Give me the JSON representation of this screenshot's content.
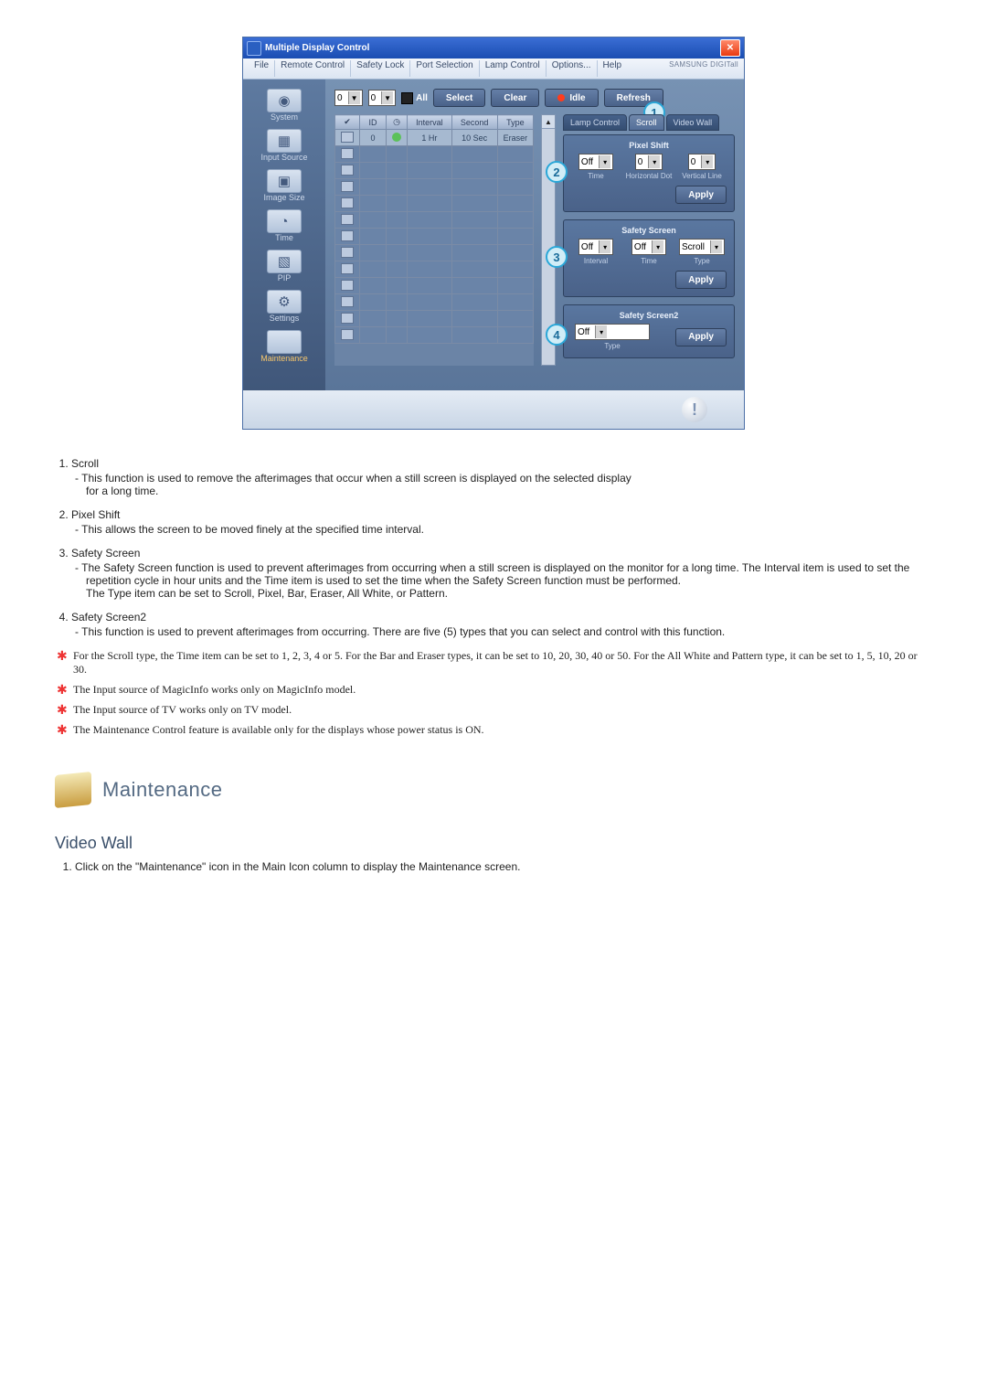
{
  "window": {
    "title": "Multiple Display Control"
  },
  "menu": {
    "file": "File",
    "remote": "Remote Control",
    "safety": "Safety Lock",
    "port": "Port Selection",
    "lamp": "Lamp Control",
    "options": "Options...",
    "help": "Help",
    "brand": "SAMSUNG DIGITall"
  },
  "sidebar": {
    "items": [
      {
        "label": "System"
      },
      {
        "label": "Input Source"
      },
      {
        "label": "Image Size"
      },
      {
        "label": "Time"
      },
      {
        "label": "PIP"
      },
      {
        "label": "Settings"
      },
      {
        "label": "Maintenance"
      }
    ]
  },
  "toolbar": {
    "dd1": "0",
    "dd2": "0",
    "all": "All",
    "select": "Select",
    "clear": "Clear",
    "idle": "Idle",
    "refresh": "Refresh"
  },
  "grid": {
    "cols": {
      "id": "ID",
      "interval": "Interval",
      "second": "Second",
      "type": "Type"
    },
    "row": {
      "id": "0",
      "interval": "1 Hr",
      "second": "10 Sec",
      "type": "Eraser"
    }
  },
  "tabs": {
    "lamp": "Lamp Control",
    "scroll": "Scroll",
    "video": "Video Wall"
  },
  "pixelshift": {
    "title": "Pixel Shift",
    "v1": "Off",
    "v2": "0",
    "v3": "0",
    "l1": "Time",
    "l2": "Horizontal Dot",
    "l3": "Vertical Line",
    "apply": "Apply"
  },
  "safetyscreen": {
    "title": "Safety Screen",
    "v1": "Off",
    "v2": "Off",
    "v3": "Scroll",
    "l1": "Interval",
    "l2": "Time",
    "l3": "Type",
    "apply": "Apply"
  },
  "safetyscreen2": {
    "title": "Safety Screen2",
    "v1": "Off",
    "l1": "Type",
    "apply": "Apply"
  },
  "callouts": {
    "c1": "1",
    "c2": "2",
    "c3": "3",
    "c4": "4"
  },
  "notes": {
    "n1": {
      "title": "Scroll",
      "a": "This function is used to remove the afterimages that occur when a still screen is displayed on the selected display",
      "b": "for a long time."
    },
    "n2": {
      "title": "Pixel Shift",
      "a": "This allows the screen to be moved finely at the specified time interval."
    },
    "n3": {
      "title": "Safety Screen",
      "a": "The Safety Screen function is used to prevent afterimages from occurring when a still screen is displayed on the monitor for a long time.  The Interval item is used to set the repetition cycle in hour units and the Time item is used to set the time when the Safety Screen function must be performed.",
      "b": "The Type item can be set to Scroll, Pixel, Bar, Eraser, All White, or Pattern."
    },
    "n4": {
      "title": "Safety Screen2",
      "a": "This function is used to prevent afterimages from occurring. There are five (5) types that you can select and control with this function."
    }
  },
  "stars": {
    "s1": "For the Scroll type, the Time item can be set to 1, 2, 3, 4 or 5. For the Bar and Eraser types, it can be set to 10, 20, 30, 40 or 50. For the All White and Pattern type, it can be set to 1, 5, 10, 20 or 30.",
    "s2": "The Input source of MagicInfo works only on MagicInfo model.",
    "s3": "The Input source of TV works only on TV model.",
    "s4": "The Maintenance Control feature is available only for the displays whose power status is ON."
  },
  "section": {
    "maint": "Maintenance",
    "videowall": "Video Wall",
    "step1": "Click on the \"Maintenance\" icon in the Main Icon column to display the Maintenance screen."
  }
}
